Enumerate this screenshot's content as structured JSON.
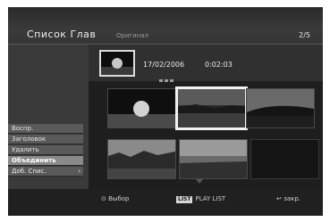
{
  "header": {
    "title": "Список Глав",
    "subtitle": "Оригинал",
    "page_count": "2/5"
  },
  "info": {
    "date": "17/02/2006",
    "time": "0:02:03"
  },
  "menu": {
    "items": [
      {
        "label": "Воспр."
      },
      {
        "label": "Заголовок"
      },
      {
        "label": "Удалить"
      },
      {
        "label": "Объединить"
      },
      {
        "label": "Доб. Спис."
      }
    ],
    "active_index": 3
  },
  "footer": {
    "select_label": "Выбор",
    "list_badge": "LIST",
    "playlist_label": "PLAY LIST",
    "close_label": "закр."
  },
  "icons": {
    "select": "circle-select-icon",
    "return": "return-arrow-icon",
    "more": "chevron-right-icon"
  }
}
